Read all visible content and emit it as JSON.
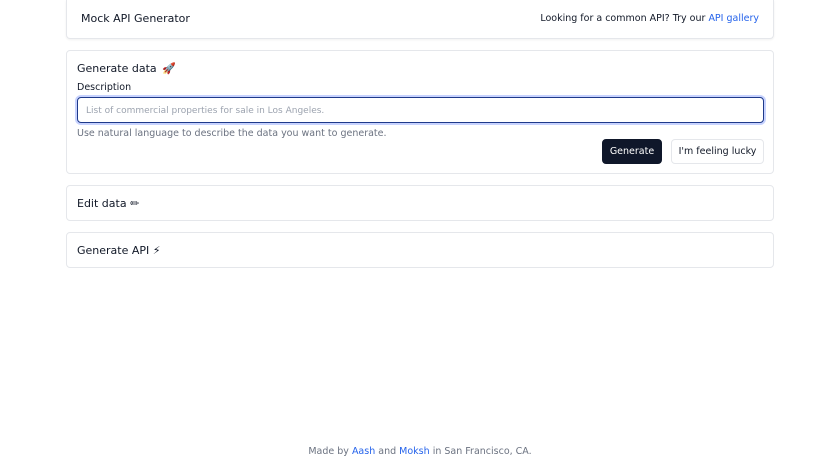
{
  "header": {
    "title": "Mock API Generator",
    "right_text": "Looking for a common API? Try our",
    "gallery_link": "API gallery"
  },
  "generate": {
    "title": "Generate data",
    "title_icon": "🚀",
    "description_label": "Description",
    "input_placeholder": "List of commercial properties for sale in Los Angeles.",
    "input_value": "",
    "helper_text": "Use natural language to describe the data you want to generate.",
    "generate_button": "Generate",
    "lucky_button": "I'm feeling lucky"
  },
  "edit": {
    "title": "Edit data",
    "title_icon": "✏"
  },
  "api": {
    "title": "Generate API",
    "title_icon": "⚡"
  },
  "footer": {
    "prefix": "Made by",
    "author1": "Aash",
    "conj": "and",
    "author2": "Moksh",
    "suffix": "in San Francisco, CA."
  },
  "colors": {
    "link": "#2563eb",
    "primary_button": "#0f172a",
    "focus_ring": "#c7d2fe"
  }
}
